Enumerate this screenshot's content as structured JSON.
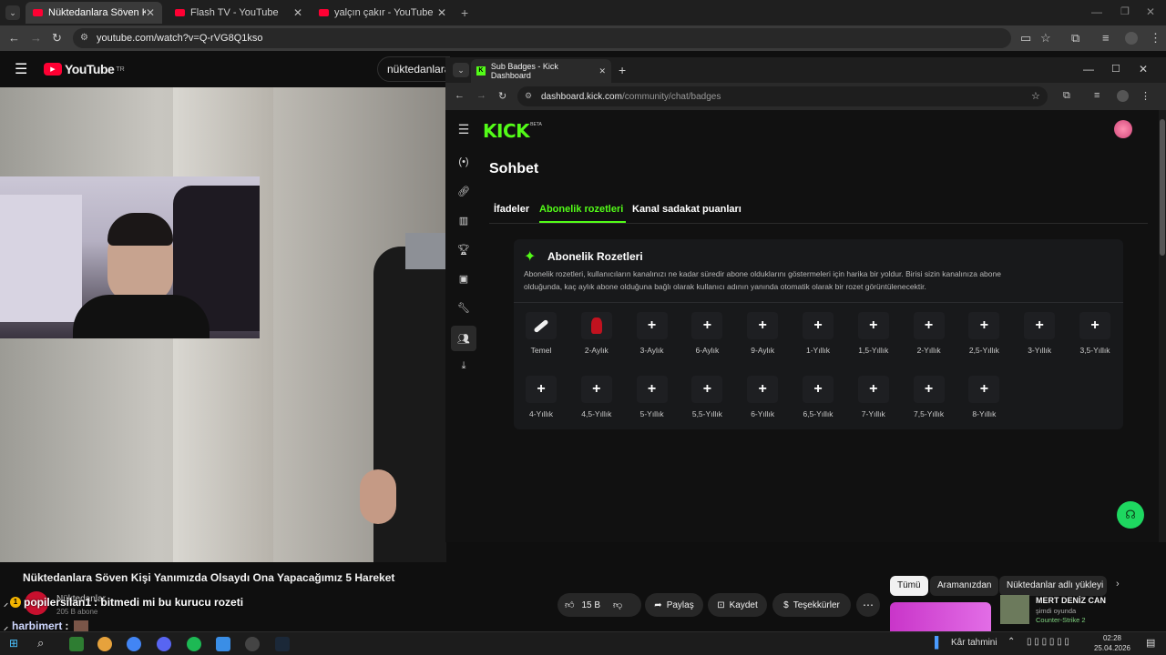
{
  "outer_tabs": [
    {
      "label": "Nüktedanlara Söven Kişi Yanım"
    },
    {
      "label": "Flash TV - YouTube"
    },
    {
      "label": "yalçın çakır - YouTube"
    }
  ],
  "outer_url": "youtube.com/watch?v=Q-rVG8Q1kso",
  "youtube": {
    "logo": "YouTube",
    "region": "TR",
    "search_value": "nüktedanlara",
    "video_title": "Nüktedanlara Söven Kişi Yanımızda Olsaydı Ona Yapacağımız 5 Hareket",
    "channel_name": "Nüktedanlar",
    "subscribers": "205 B abone",
    "likes": "15 B",
    "share": "Paylaş",
    "save": "Kaydet",
    "thanks": "Teşekkürler",
    "chips": [
      "Tümü",
      "Aramanızdan",
      "Nüktedanlar adlı yükleyi"
    ],
    "rec_title": "MERT DENİZ CAN",
    "rec_sub1": "şimdi oyunda",
    "rec_sub2": "Counter-Strike 2"
  },
  "overlay_chat": [
    {
      "user": "popilersilan1",
      "badge": "1",
      "message": ": bitmedi mi bu kurucu rozeti"
    },
    {
      "user": "harbimert",
      "message": ":"
    }
  ],
  "kick_window": {
    "tab_title": "Sub Badges - Kick Dashboard",
    "url_host": "dashboard.kick.com",
    "url_path": "/community/chat/badges",
    "logo": "KICK",
    "logo_tag": "BETA",
    "page_title": "Sohbet",
    "tabs": [
      "İfadeler",
      "Abonelik rozetleri",
      "Kanal sadakat puanları"
    ],
    "active_tab": 1,
    "card_title": "Abonelik Rozetleri",
    "card_desc_1": "Abonelik rozetleri, kullanıcıların kanalınızı ne kadar süredir abone olduklarını göstermeleri için harika bir yoldur. Birisi sizin kanalınıza abone",
    "card_desc_2": "olduğunda, kaç aylık abone olduğuna bağlı olarak kullanıcı adının yanında otomatik olarak bir rozet görüntülenecektir.",
    "badges_row1": [
      "Temel",
      "2-Aylık",
      "3-Aylık",
      "6-Aylık",
      "9-Aylık",
      "1-Yıllık",
      "1,5-Yıllık",
      "2-Yıllık",
      "2,5-Yıllık",
      "3-Yıllık",
      "3,5-Yıllık"
    ],
    "badges_row2": [
      "4-Yıllık",
      "4,5-Yıllık",
      "5-Yıllık",
      "5,5-Yıllık",
      "6-Yıllık",
      "6,5-Yıllık",
      "7-Yıllık",
      "7,5-Yıllık",
      "8-Yıllık"
    ],
    "add_symbol": "+"
  },
  "taskbar": {
    "weather": "Kâr tahmini",
    "time": "02:28",
    "date": "25.04.2026"
  },
  "colors": {
    "kick_green": "#53fc18",
    "yt_red": "#ff0033"
  }
}
